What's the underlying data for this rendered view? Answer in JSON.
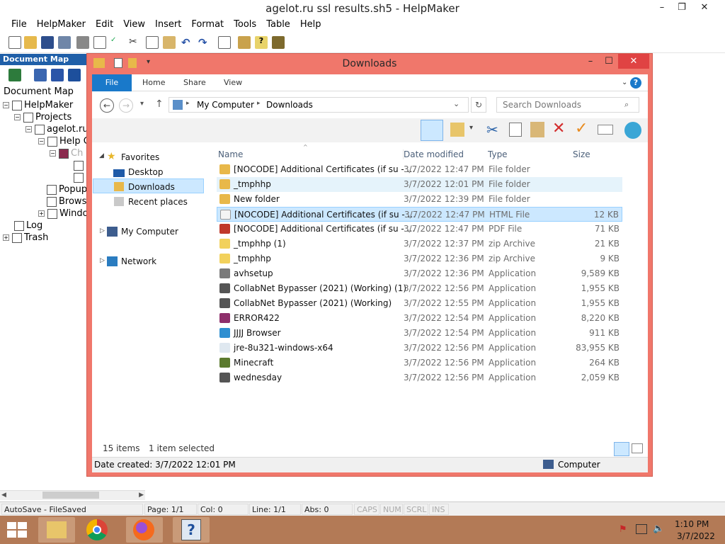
{
  "helpmaker": {
    "title": "agelot.ru ssl results.sh5 - HelpMaker",
    "controls": [
      "–",
      "❐",
      "✕"
    ],
    "menu": [
      "File",
      "HelpMaker",
      "Edit",
      "View",
      "Insert",
      "Format",
      "Tools",
      "Table",
      "Help"
    ],
    "docmap_header": "Document Map",
    "docmap_label": "Document Map",
    "tree": {
      "root": "HelpMaker",
      "projects": "Projects",
      "project": "agelot.ru",
      "help": "Help C",
      "chapter": "Ch",
      "popup": "Popup",
      "browse": "Brows",
      "window": "Windo",
      "log": "Log",
      "trash": "Trash"
    },
    "status": {
      "autosave": "AutoSave - FileSaved",
      "page": "Page: 1/1",
      "col": "Col: 0",
      "line": "Line: 1/1",
      "abs": "Abs: 0",
      "caps": "CAPS",
      "num": "NUM",
      "scrl": "SCRL",
      "ins": "INS"
    }
  },
  "explorer": {
    "title": "Downloads",
    "controls": [
      "–",
      "☐",
      "✕"
    ],
    "ribbon_tabs": [
      "File",
      "Home",
      "Share",
      "View"
    ],
    "breadcrumb": [
      "My Computer",
      "Downloads"
    ],
    "search_placeholder": "Search Downloads",
    "nav": {
      "favorites": "Favorites",
      "desktop": "Desktop",
      "downloads": "Downloads",
      "recent": "Recent places",
      "computer": "My Computer",
      "network": "Network"
    },
    "columns": [
      "Name",
      "Date modified",
      "Type",
      "Size"
    ],
    "files": [
      {
        "name": "[NOCODE] Additional Certificates (if su - ...",
        "date": "3/7/2022 12:47 PM",
        "type": "File folder",
        "size": "",
        "icon": "folder-icon",
        "color": "#e8b84a"
      },
      {
        "name": "_tmphhp",
        "date": "3/7/2022 12:01 PM",
        "type": "File folder",
        "size": "",
        "icon": "folder-icon",
        "color": "#e8b84a"
      },
      {
        "name": "New folder",
        "date": "3/7/2022 12:39 PM",
        "type": "File folder",
        "size": "",
        "icon": "folder-icon",
        "color": "#e8b84a"
      },
      {
        "name": "[NOCODE] Additional Certificates (if su - ...",
        "date": "3/7/2022 12:47 PM",
        "type": "HTML File",
        "size": "12 KB",
        "icon": "html-file-icon",
        "color": "#f4f4f4"
      },
      {
        "name": "[NOCODE] Additional Certificates (if su - ...",
        "date": "3/7/2022 12:47 PM",
        "type": "PDF File",
        "size": "71 KB",
        "icon": "pdf-file-icon",
        "color": "#c0392b"
      },
      {
        "name": "_tmphhp (1)",
        "date": "3/7/2022 12:37 PM",
        "type": "zip Archive",
        "size": "21 KB",
        "icon": "zip-archive-icon",
        "color": "#f2d15c"
      },
      {
        "name": "_tmphhp",
        "date": "3/7/2022 12:36 PM",
        "type": "zip Archive",
        "size": "9 KB",
        "icon": "zip-archive-icon",
        "color": "#f2d15c"
      },
      {
        "name": "avhsetup",
        "date": "3/7/2022 12:36 PM",
        "type": "Application",
        "size": "9,589 KB",
        "icon": "setup-app-icon",
        "color": "#7a7a7a"
      },
      {
        "name": "CollabNet Bypasser (2021) (Working) (1)",
        "date": "3/7/2022 12:56 PM",
        "type": "Application",
        "size": "1,955 KB",
        "icon": "app-icon",
        "color": "#555555"
      },
      {
        "name": "CollabNet Bypasser (2021) (Working)",
        "date": "3/7/2022 12:55 PM",
        "type": "Application",
        "size": "1,955 KB",
        "icon": "app-icon",
        "color": "#555555"
      },
      {
        "name": "ERROR422",
        "date": "3/7/2022 12:54 PM",
        "type": "Application",
        "size": "8,220 KB",
        "icon": "error-app-icon",
        "color": "#8e2f6b"
      },
      {
        "name": "JJJJ Browser",
        "date": "3/7/2022 12:54 PM",
        "type": "Application",
        "size": "911 KB",
        "icon": "globe-icon",
        "color": "#2f8fd1"
      },
      {
        "name": "jre-8u321-windows-x64",
        "date": "3/7/2022 12:56 PM",
        "type": "Application",
        "size": "83,955 KB",
        "icon": "java-icon",
        "color": "#dfe8f0"
      },
      {
        "name": "Minecraft",
        "date": "3/7/2022 12:56 PM",
        "type": "Application",
        "size": "264 KB",
        "icon": "minecraft-icon",
        "color": "#5b7a2e"
      },
      {
        "name": "wednesday",
        "date": "3/7/2022 12:56 PM",
        "type": "Application",
        "size": "2,059 KB",
        "icon": "app-icon",
        "color": "#555555"
      }
    ],
    "status_items": "15 items",
    "status_selected": "1 item selected",
    "date_created": "Date created: 3/7/2022 12:01 PM",
    "location": "Computer"
  },
  "taskbar": {
    "time": "1:10 PM",
    "date": "3/7/2022"
  }
}
